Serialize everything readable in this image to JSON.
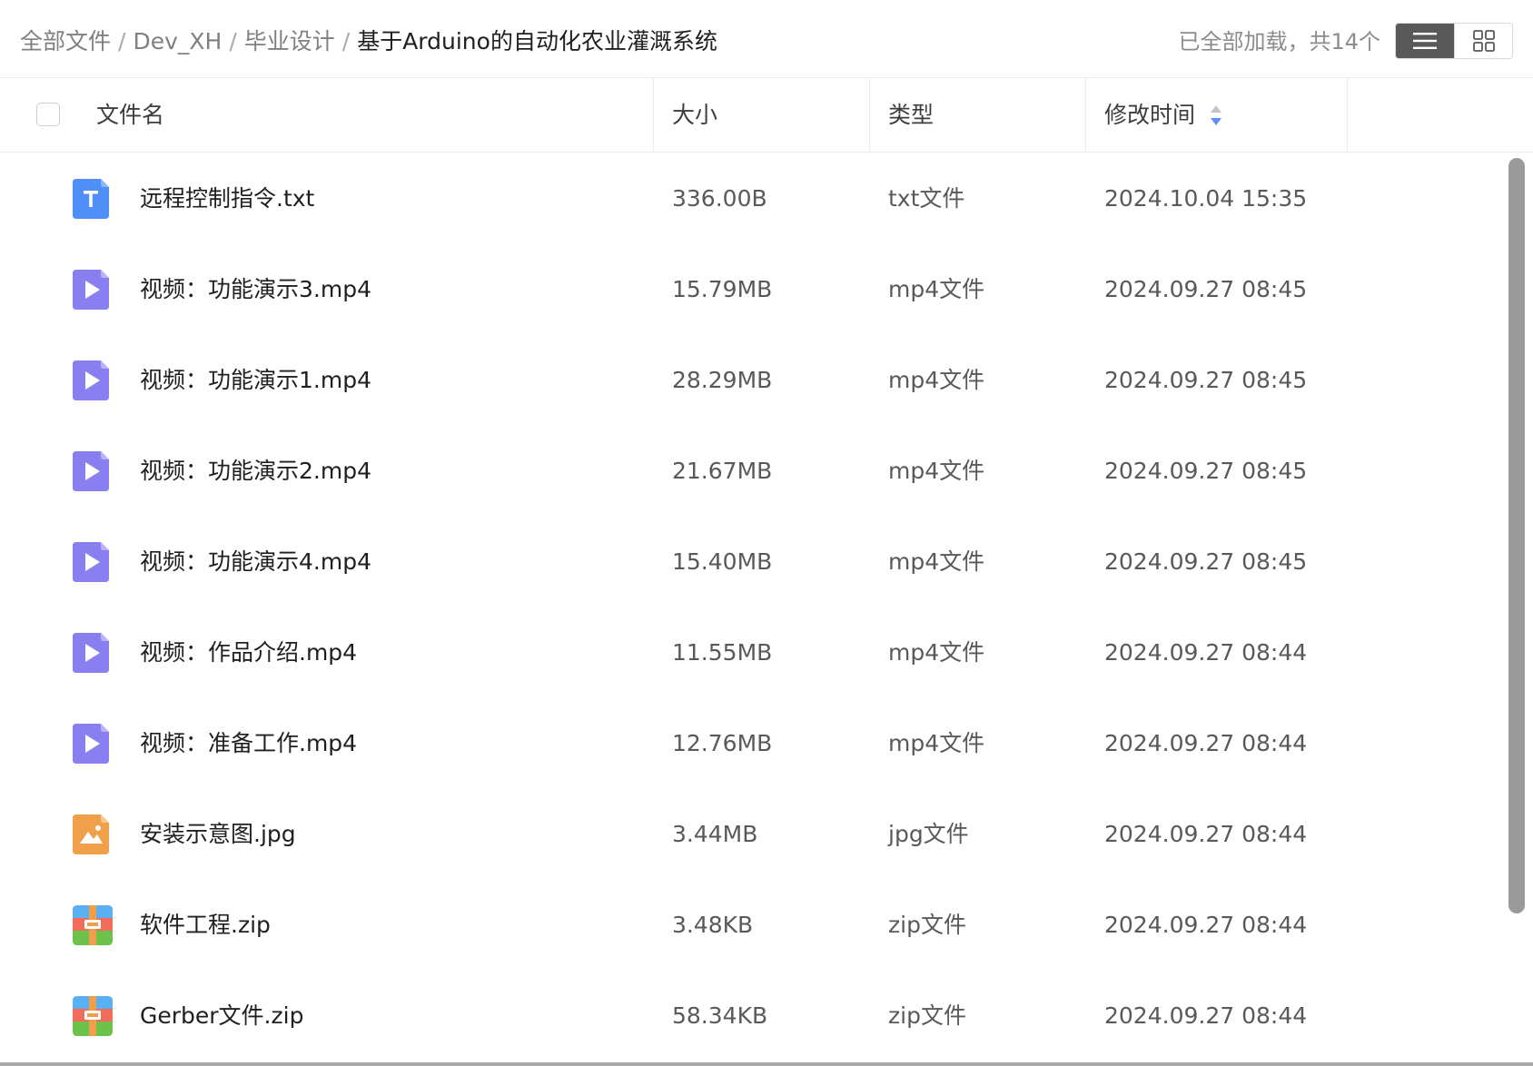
{
  "breadcrumb": {
    "items": [
      "全部文件",
      "Dev_XH",
      "毕业设计"
    ],
    "current": "基于Arduino的自动化农业灌溉系统",
    "separator": "/"
  },
  "load_status": "已全部加载，共14个",
  "view_toggle": {
    "active": "list",
    "list_icon": "list-view-icon",
    "grid_icon": "grid-view-icon"
  },
  "columns": {
    "name": "文件名",
    "size": "大小",
    "type": "类型",
    "modified": "修改时间"
  },
  "sort": {
    "column": "modified",
    "icon": "sort-caret-icon",
    "active_color": "#5b8ff9"
  },
  "icon_colors": {
    "txt": "#4f8ff7",
    "mp4": "#8a7ff0",
    "jpg": "#f0a04b",
    "zip_top": "#5ab0f0",
    "zip_mid": "#f26b5b",
    "zip_bottom": "#6cc24a"
  },
  "files": [
    {
      "name": "远程控制指令.txt",
      "size": "336.00B",
      "type": "txt文件",
      "modified": "2024.10.04 15:35",
      "kind": "txt"
    },
    {
      "name": "视频：功能演示3.mp4",
      "size": "15.79MB",
      "type": "mp4文件",
      "modified": "2024.09.27 08:45",
      "kind": "mp4"
    },
    {
      "name": "视频：功能演示1.mp4",
      "size": "28.29MB",
      "type": "mp4文件",
      "modified": "2024.09.27 08:45",
      "kind": "mp4"
    },
    {
      "name": "视频：功能演示2.mp4",
      "size": "21.67MB",
      "type": "mp4文件",
      "modified": "2024.09.27 08:45",
      "kind": "mp4"
    },
    {
      "name": "视频：功能演示4.mp4",
      "size": "15.40MB",
      "type": "mp4文件",
      "modified": "2024.09.27 08:45",
      "kind": "mp4"
    },
    {
      "name": "视频：作品介绍.mp4",
      "size": "11.55MB",
      "type": "mp4文件",
      "modified": "2024.09.27 08:44",
      "kind": "mp4"
    },
    {
      "name": "视频：准备工作.mp4",
      "size": "12.76MB",
      "type": "mp4文件",
      "modified": "2024.09.27 08:44",
      "kind": "mp4"
    },
    {
      "name": "安装示意图.jpg",
      "size": "3.44MB",
      "type": "jpg文件",
      "modified": "2024.09.27 08:44",
      "kind": "jpg"
    },
    {
      "name": "软件工程.zip",
      "size": "3.48KB",
      "type": "zip文件",
      "modified": "2024.09.27 08:44",
      "kind": "zip"
    },
    {
      "name": "Gerber文件.zip",
      "size": "58.34KB",
      "type": "zip文件",
      "modified": "2024.09.27 08:44",
      "kind": "zip"
    }
  ]
}
